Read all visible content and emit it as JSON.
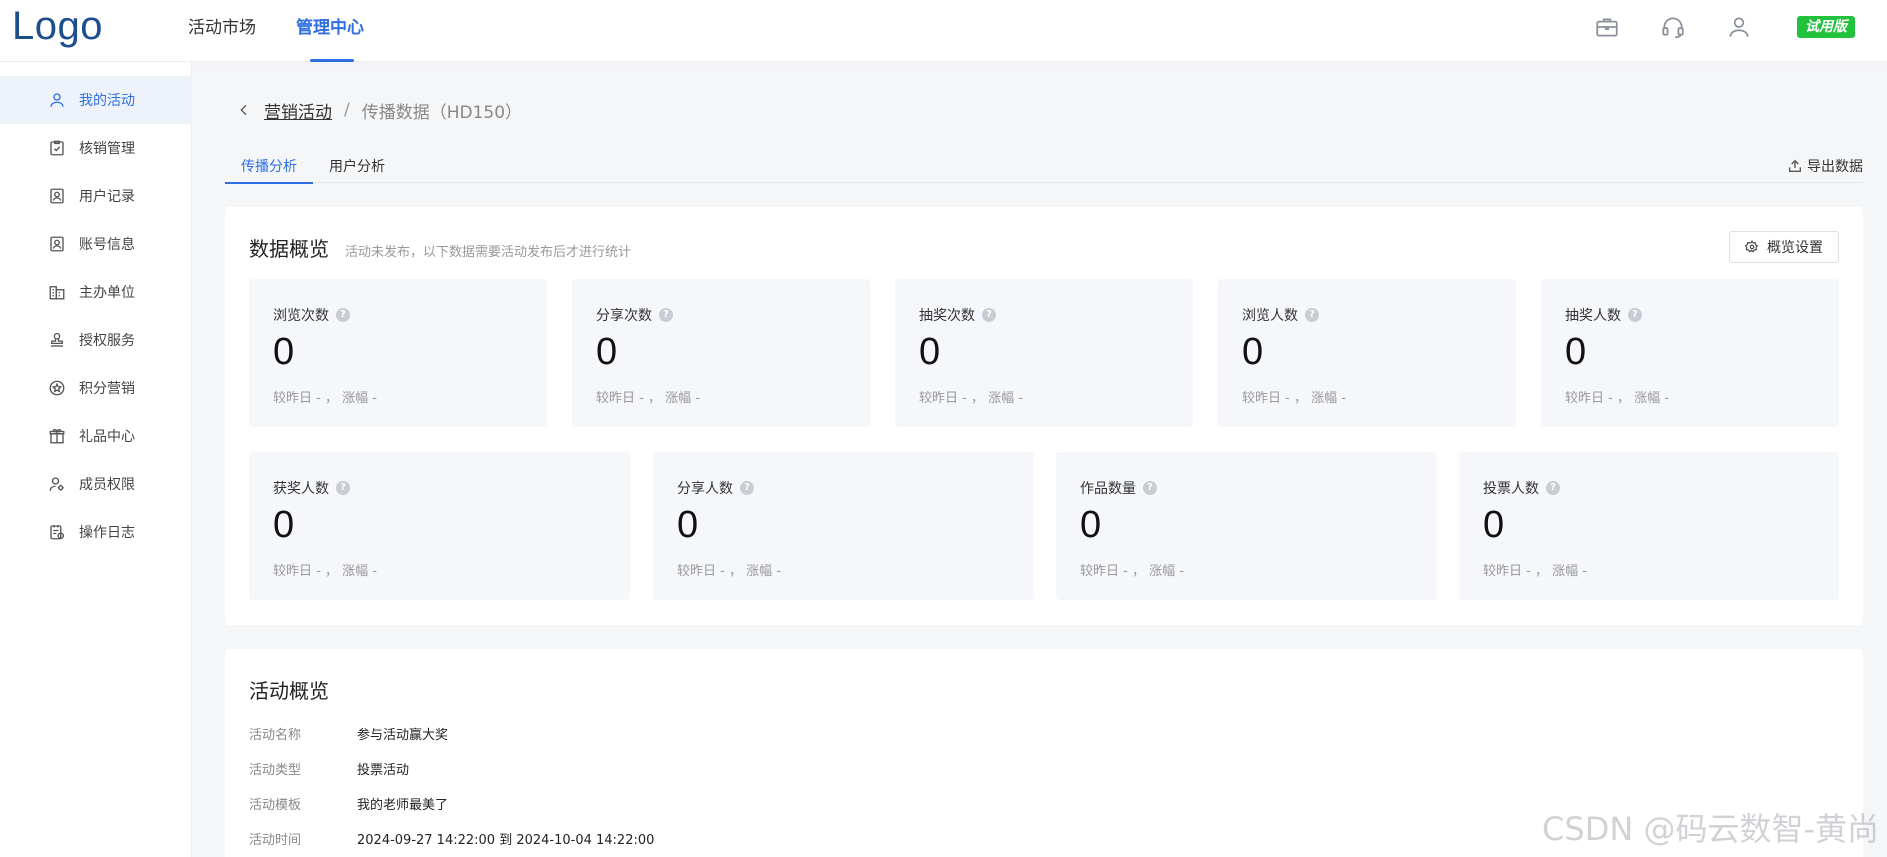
{
  "header": {
    "logo": "Logo",
    "nav": [
      {
        "label": "活动市场"
      },
      {
        "label": "管理中心"
      }
    ],
    "trial_badge": "试用版"
  },
  "sidebar": {
    "items": [
      {
        "label": "我的活动",
        "icon": "user-icon"
      },
      {
        "label": "核销管理",
        "icon": "verify-icon"
      },
      {
        "label": "用户记录",
        "icon": "user-record-icon"
      },
      {
        "label": "账号信息",
        "icon": "account-icon"
      },
      {
        "label": "主办单位",
        "icon": "organizer-icon"
      },
      {
        "label": "授权服务",
        "icon": "authorization-icon"
      },
      {
        "label": "积分营销",
        "icon": "points-icon"
      },
      {
        "label": "礼品中心",
        "icon": "gift-icon"
      },
      {
        "label": "成员权限",
        "icon": "member-permission-icon"
      },
      {
        "label": "操作日志",
        "icon": "log-icon"
      }
    ]
  },
  "breadcrumb": {
    "parent": "营销活动",
    "separator": "/",
    "current": "传播数据（HD150）"
  },
  "tabs": [
    {
      "label": "传播分析"
    },
    {
      "label": "用户分析"
    }
  ],
  "export_label": "导出数据",
  "overview": {
    "title": "数据概览",
    "subtitle": "活动未发布，以下数据需要活动发布后才进行统计",
    "settings_label": "概览设置",
    "stats_row1": [
      {
        "label": "浏览次数",
        "value": "0",
        "compare": "较昨日 - ， 涨幅 -"
      },
      {
        "label": "分享次数",
        "value": "0",
        "compare": "较昨日 - ， 涨幅 -"
      },
      {
        "label": "抽奖次数",
        "value": "0",
        "compare": "较昨日 - ， 涨幅 -"
      },
      {
        "label": "浏览人数",
        "value": "0",
        "compare": "较昨日 - ， 涨幅 -"
      },
      {
        "label": "抽奖人数",
        "value": "0",
        "compare": "较昨日 - ， 涨幅 -"
      }
    ],
    "stats_row2": [
      {
        "label": "获奖人数",
        "value": "0",
        "compare": "较昨日 - ， 涨幅 -"
      },
      {
        "label": "分享人数",
        "value": "0",
        "compare": "较昨日 - ， 涨幅 -"
      },
      {
        "label": "作品数量",
        "value": "0",
        "compare": "较昨日 - ， 涨幅 -"
      },
      {
        "label": "投票人数",
        "value": "0",
        "compare": "较昨日 - ， 涨幅 -"
      }
    ]
  },
  "activity": {
    "title": "活动概览",
    "rows": [
      {
        "key": "活动名称",
        "value": "参与活动赢大奖"
      },
      {
        "key": "活动类型",
        "value": "投票活动"
      },
      {
        "key": "活动模板",
        "value": "我的老师最美了"
      },
      {
        "key": "活动时间",
        "value": "2024-09-27 14:22:00 到 2024-10-04 14:22:00"
      }
    ]
  },
  "watermark": "CSDN @码云数智-黄尚"
}
